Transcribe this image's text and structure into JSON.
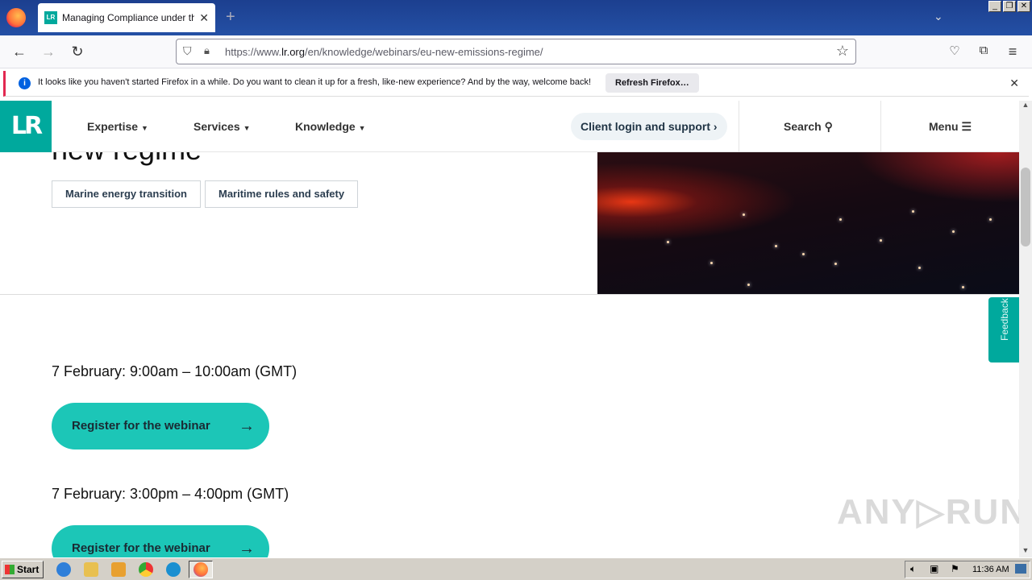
{
  "browser": {
    "tab_title": "Managing Compliance under the EU",
    "tab_favicon_text": "LR",
    "url_prefix": "https://www.",
    "url_domain": "lr.org",
    "url_path": "/en/knowledge/webinars/eu-new-emissions-regime/",
    "window_controls": [
      "_",
      "❐",
      "✕"
    ]
  },
  "notification": {
    "text": "It looks like you haven't started Firefox in a while. Do you want to clean it up for a fresh, like-new experience? And by the way, welcome back!",
    "button_label": "Refresh Firefox…"
  },
  "site_header": {
    "logo_text": "LR",
    "nav": [
      {
        "label": "Expertise"
      },
      {
        "label": "Services"
      },
      {
        "label": "Knowledge"
      }
    ],
    "client_login_label": "Client login and support",
    "search_label": "Search",
    "menu_label": "Menu"
  },
  "hero": {
    "heading_partial": "new regime",
    "tags": [
      "Marine energy transition",
      "Maritime rules and safety"
    ]
  },
  "events": [
    {
      "time": "7 February: 9:00am – 10:00am (GMT)",
      "button_label": "Register for the webinar"
    },
    {
      "time": "7 February: 3:00pm – 4:00pm (GMT)",
      "button_label": "Register for the webinar"
    }
  ],
  "feedback_label": "Feedback",
  "watermark": "ANY▷RUN",
  "taskbar": {
    "start_label": "Start",
    "clock": "11:36 AM"
  }
}
